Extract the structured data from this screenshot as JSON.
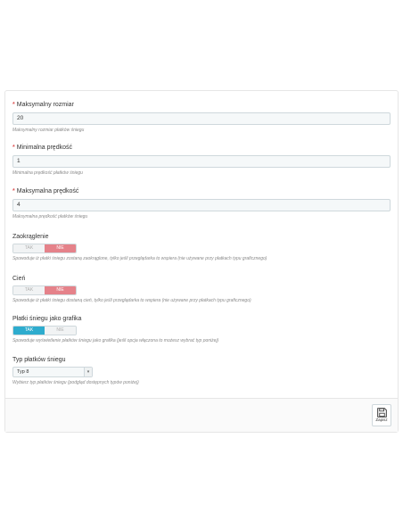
{
  "fields": {
    "max_size": {
      "label": "Maksymalny rozmiar",
      "value": "20",
      "help": "Maksymalny rozmiar płatków śniegu"
    },
    "min_speed": {
      "label": "Minimalna prędkość",
      "value": "1",
      "help": "Minimalna prędkość płatków śniegu"
    },
    "max_speed": {
      "label": "Maksymalna prędkość",
      "value": "4",
      "help": "Maksymalna prędkość płatków śniegu"
    },
    "rounding": {
      "label": "Zaokrąglenie",
      "yes": "TAK",
      "no": "NIE",
      "selected": "NIE",
      "help": "Spowoduje iż płatki śniegu zostaną zaokrąglone, tylko jeśli przeglądarka to wspiera (nie używane przy płatkach typu graficznego)"
    },
    "shadow": {
      "label": "Cień",
      "yes": "TAK",
      "no": "NIE",
      "selected": "NIE",
      "help": "Spowoduje iż płatki śniegu dostaną cień, tylko jeśli przeglądarka to wspiera (nie używane przy płatkach typu graficznego)"
    },
    "as_graphic": {
      "label": "Płatki śniegu jako grafika",
      "yes": "TAK",
      "no": "NIE",
      "selected": "TAK",
      "help": "Spowoduje wyświetlenie płatków śniegu jako grafika (jeśli opcja włączona to możesz wybrać typ poniżej)"
    },
    "flake_type": {
      "label": "Typ płatków śniegu",
      "value": "Typ 8",
      "help": "Wybierz typ płatków śniegu (podgląd dostępnych typów poniżej)"
    }
  },
  "required_marker": "*",
  "footer": {
    "save_label": "Zapisz"
  },
  "icons": {
    "save": "floppy-disk-icon",
    "select_arrow": "chevron-down-icon"
  },
  "colors": {
    "accent": "#2eacce",
    "no_active": "#e5828a",
    "required": "#e05a5a"
  }
}
